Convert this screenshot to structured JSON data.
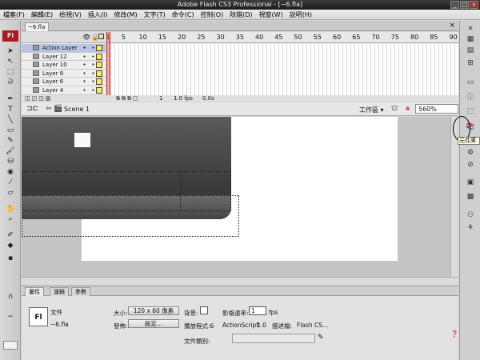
{
  "window": {
    "title": "Adobe Flash CS3 Professional - [~6.fla]",
    "buttons": [
      "_",
      "□",
      "×"
    ]
  },
  "menu": [
    "檔案(F)",
    "編輯(E)",
    "檢視(V)",
    "插入(I)",
    "修改(M)",
    "文字(T)",
    "命令(C)",
    "控制(O)",
    "除錯(D)",
    "視窗(W)",
    "說明(H)"
  ],
  "logo": "Fl",
  "document_tab": "~6.fla",
  "timeline": {
    "layers": [
      {
        "name": "Action Layer",
        "active": true
      },
      {
        "name": "Layer 12"
      },
      {
        "name": "Layer 10"
      },
      {
        "name": "Layer 8"
      },
      {
        "name": "Layer 6"
      },
      {
        "name": "Layer 4"
      }
    ],
    "frame_numbers": [
      "1",
      "5",
      "10",
      "15",
      "20",
      "25",
      "30",
      "35",
      "40",
      "45",
      "50",
      "55",
      "60",
      "65",
      "70",
      "75",
      "80",
      "85",
      "90"
    ],
    "current_frame": "1",
    "frame_rate": "1.0 fps",
    "elapsed": "0.0s"
  },
  "stage": {
    "scene": "Scene 1",
    "workspace": "工作區 ▾",
    "zoom": "560%"
  },
  "library_tooltip": "元件庫",
  "properties": {
    "tabs": [
      "屬性",
      "濾鏡",
      "參數"
    ],
    "doc_type": "文件",
    "doc_name": "~6.fla",
    "size_label": "大小:",
    "size_value": "120 x 60 像素",
    "background_label": "背景:",
    "framerate_label": "影格速率:",
    "framerate_value": "1",
    "fps_unit": "fps",
    "publish_label": "發佈:",
    "settings_button": "設定...",
    "player_label": "播放程式:6",
    "actionscript_label": "ActionScript:",
    "actionscript_value": "1.0",
    "profile_label": "描述檔:",
    "profile_value": "Flash CS...",
    "doc_class_label": "文件類別:"
  }
}
